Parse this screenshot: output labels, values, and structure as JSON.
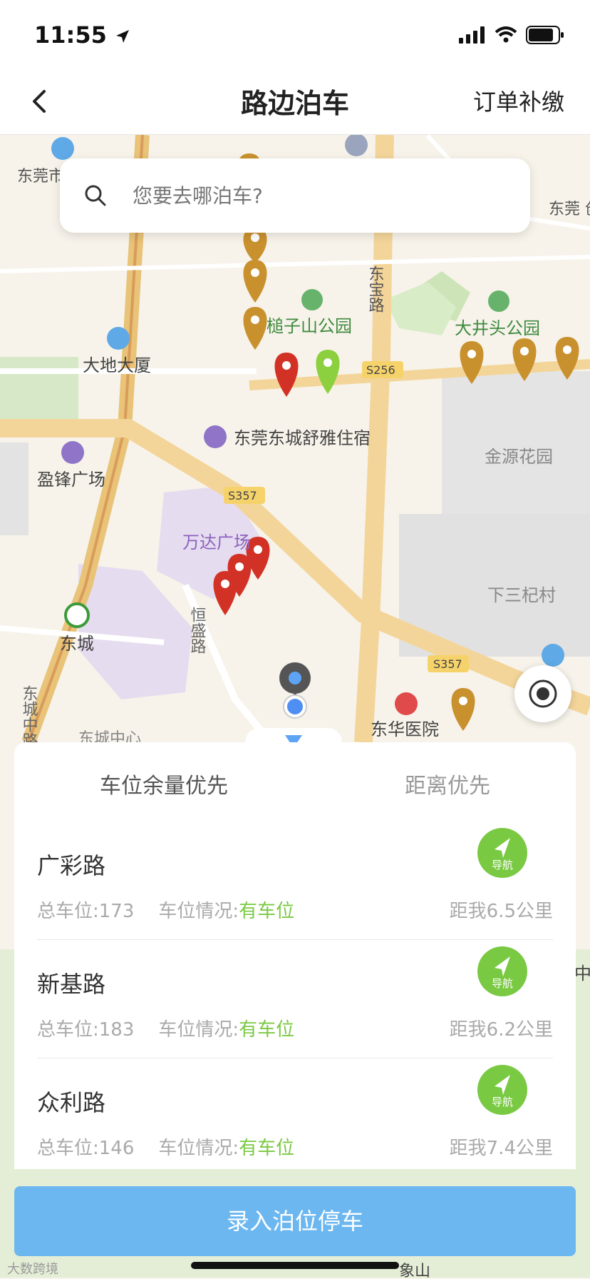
{
  "status": {
    "time": "11:55"
  },
  "nav": {
    "title": "路边泊车",
    "right_link": "订单补缴"
  },
  "search": {
    "placeholder": "您要去哪泊车?"
  },
  "map_labels": {
    "dongguan_tianbao": "东莞市\n天宝",
    "dongguan_chuangyi": "东莞\n创意",
    "dongbao_road": "东宝路",
    "zhuizishan_park": "槌子山公园",
    "dajingtou_park": "大井头公园",
    "dadi_building": "大地大厦",
    "s256": "S256",
    "shuya_hotel": "东莞东城舒雅住宿",
    "yingfeng_plaza": "盈锋广场",
    "jinyuan_garden": "金源花园",
    "s357_a": "S357",
    "wanda_plaza": "万达广场",
    "hengsheng_road": "恒盛路",
    "xiasanqi_village": "下三杞村",
    "dongcheng": "东城",
    "s357_b": "S357",
    "donghua_hospital": "东华医院",
    "dongcheng_center": "东城中心",
    "dongcheng_middle_road": "东城中路",
    "xiangshan": "象山",
    "zhong": "中"
  },
  "tabs": {
    "active": "车位余量优先",
    "inactive": "距离优先"
  },
  "list": [
    {
      "name": "广彩路",
      "total_label": "总车位:",
      "total": "173",
      "status_label": "车位情况:",
      "status": "有车位",
      "nav_label": "导航",
      "distance": "距我6.5公里"
    },
    {
      "name": "新基路",
      "total_label": "总车位:",
      "total": "183",
      "status_label": "车位情况:",
      "status": "有车位",
      "nav_label": "导航",
      "distance": "距我6.2公里"
    },
    {
      "name": "众利路",
      "total_label": "总车位:",
      "total": "146",
      "status_label": "车位情况:",
      "status": "有车位",
      "nav_label": "导航",
      "distance": "距我7.4公里"
    }
  ],
  "primary_button": "录入泊位停车",
  "watermark": "大数跨境",
  "colors": {
    "accent_green": "#7ac943",
    "button_blue": "#6cb7f0",
    "pin_gold": "#c9912e",
    "pin_red": "#d23226"
  }
}
